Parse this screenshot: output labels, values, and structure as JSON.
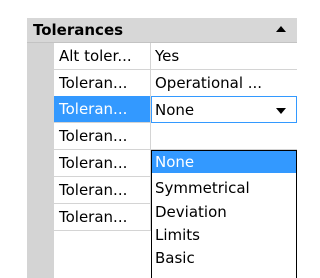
{
  "section": {
    "title": "Tolerances"
  },
  "properties": [
    {
      "name": "Alt toler...",
      "value": "Yes"
    },
    {
      "name": "Toleran...",
      "value": "Operational ..."
    },
    {
      "name": "Toleran...",
      "value": "None"
    },
    {
      "name": "Toleran...",
      "value": ""
    },
    {
      "name": "Toleran...",
      "value": ""
    },
    {
      "name": "Toleran...",
      "value": ""
    },
    {
      "name": "Toleran...",
      "value": ""
    }
  ],
  "dropdown": {
    "selected": "None",
    "options": [
      "None",
      "Symmetrical",
      "Deviation",
      "Limits",
      "Basic"
    ]
  },
  "colors": {
    "selection": "#3399ff",
    "header_bg": "#d7d7d7",
    "grid": "#d4d4d4"
  }
}
